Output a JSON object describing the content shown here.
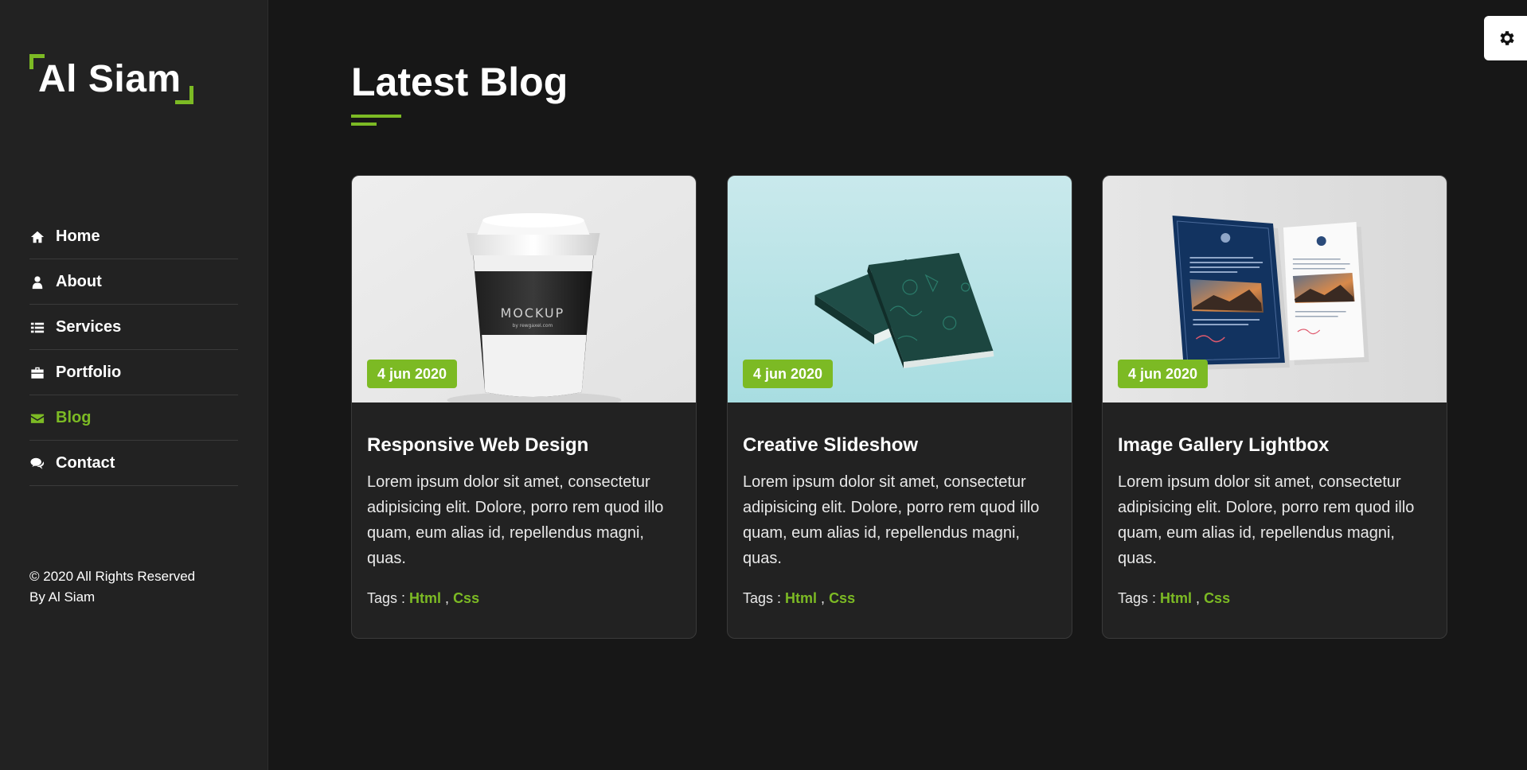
{
  "brand": {
    "logo_text": "Al Siam",
    "accent_color": "#7cba24"
  },
  "nav": {
    "items": [
      {
        "label": "Home",
        "icon": "home-icon",
        "active": false
      },
      {
        "label": "About",
        "icon": "user-icon",
        "active": false
      },
      {
        "label": "Services",
        "icon": "list-icon",
        "active": false
      },
      {
        "label": "Portfolio",
        "icon": "briefcase-icon",
        "active": false
      },
      {
        "label": "Blog",
        "icon": "envelope-icon",
        "active": true
      },
      {
        "label": "Contact",
        "icon": "comments-icon",
        "active": false
      }
    ]
  },
  "footer": {
    "line1": "© 2020 All Rights Reserved",
    "line2": "By Al Siam"
  },
  "settings": {
    "icon": "gear-icon"
  },
  "section": {
    "title": "Latest Blog"
  },
  "posts": [
    {
      "date": "4 jun 2020",
      "title": "Responsive Web Design",
      "text": "Lorem ipsum dolor sit amet, consectetur adipisicing elit. Dolore, porro rem quod illo quam, eum alias id, repellendus magni, quas.",
      "tags_label": "Tags :",
      "tags": [
        "Html",
        "Css"
      ],
      "image": "coffee-cup-mockup",
      "image_text": "MOCKUP",
      "image_subtext": "by rewgaxel.com"
    },
    {
      "date": "4 jun 2020",
      "title": "Creative Slideshow",
      "text": "Lorem ipsum dolor sit amet, consectetur adipisicing elit. Dolore, porro rem quod illo quam, eum alias id, repellendus magni, quas.",
      "tags_label": "Tags :",
      "tags": [
        "Html",
        "Css"
      ],
      "image": "book-mockup"
    },
    {
      "date": "4 jun 2020",
      "title": "Image Gallery Lightbox",
      "text": "Lorem ipsum dolor sit amet, consectetur adipisicing elit. Dolore, porro rem quod illo quam, eum alias id, repellendus magni, quas.",
      "tags_label": "Tags :",
      "tags": [
        "Html",
        "Css"
      ],
      "image": "letterhead-mockup"
    }
  ]
}
